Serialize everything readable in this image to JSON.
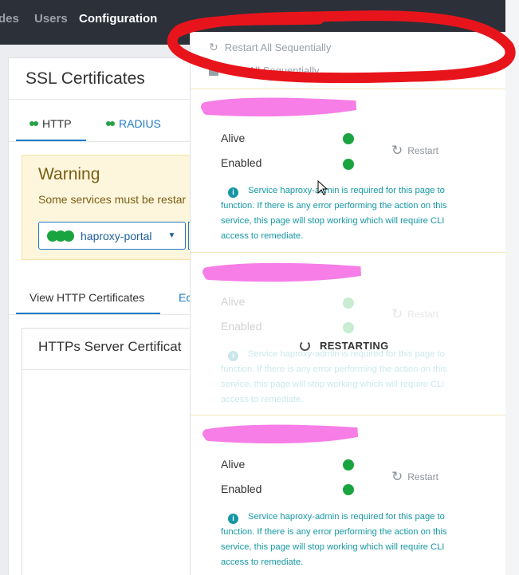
{
  "nav": {
    "items": [
      {
        "label": "des",
        "active": false
      },
      {
        "label": "Users",
        "active": false
      },
      {
        "label": "Configuration",
        "active": true
      }
    ]
  },
  "page": {
    "title": "SSL Certificates",
    "tabs": [
      {
        "label": "HTTP",
        "status_color": "#27a14a",
        "active": true
      },
      {
        "label": "RADIUS",
        "status_color": "#27a14a",
        "active": false
      }
    ],
    "warning": {
      "title": "Warning",
      "text": "Some services must be restar",
      "service_button": "haproxy-portal"
    },
    "view_tabs": [
      "View HTTP Certificates",
      "Ec"
    ],
    "https_card_title": "HTTPs Server Certificat"
  },
  "dropdown": {
    "menu": {
      "restart_all": "Restart All Sequentially",
      "stop_all": "Stop All Sequentially"
    },
    "services": [
      {
        "alive_label": "Alive",
        "enabled_label": "Enabled",
        "restart_label": "Restart",
        "info": "Service haproxy-admin is required for this page to function. If there is any error performing the action on this service, this page will stop working which will require CLI access to remediate."
      },
      {
        "alive_label": "Alive",
        "enabled_label": "Enabled",
        "restart_label": "Restart",
        "status_overlay": "RESTARTING",
        "info": "Service haproxy-admin is required for this page to function. If there is any error performing the action on this service, this page will stop working which will require CLI access to remediate."
      },
      {
        "alive_label": "Alive",
        "enabled_label": "Enabled",
        "restart_label": "Restart",
        "info": "Service haproxy-admin is required for this page to function. If there is any error performing the action on this service, this page will stop working which will require CLI access to remediate."
      }
    ]
  },
  "colors": {
    "status_green": "#1aa43f",
    "info_teal": "#1597a3",
    "link_blue": "#1f7ac8",
    "annotation_red": "#e8141c",
    "redaction_pink": "#f77ee6"
  }
}
